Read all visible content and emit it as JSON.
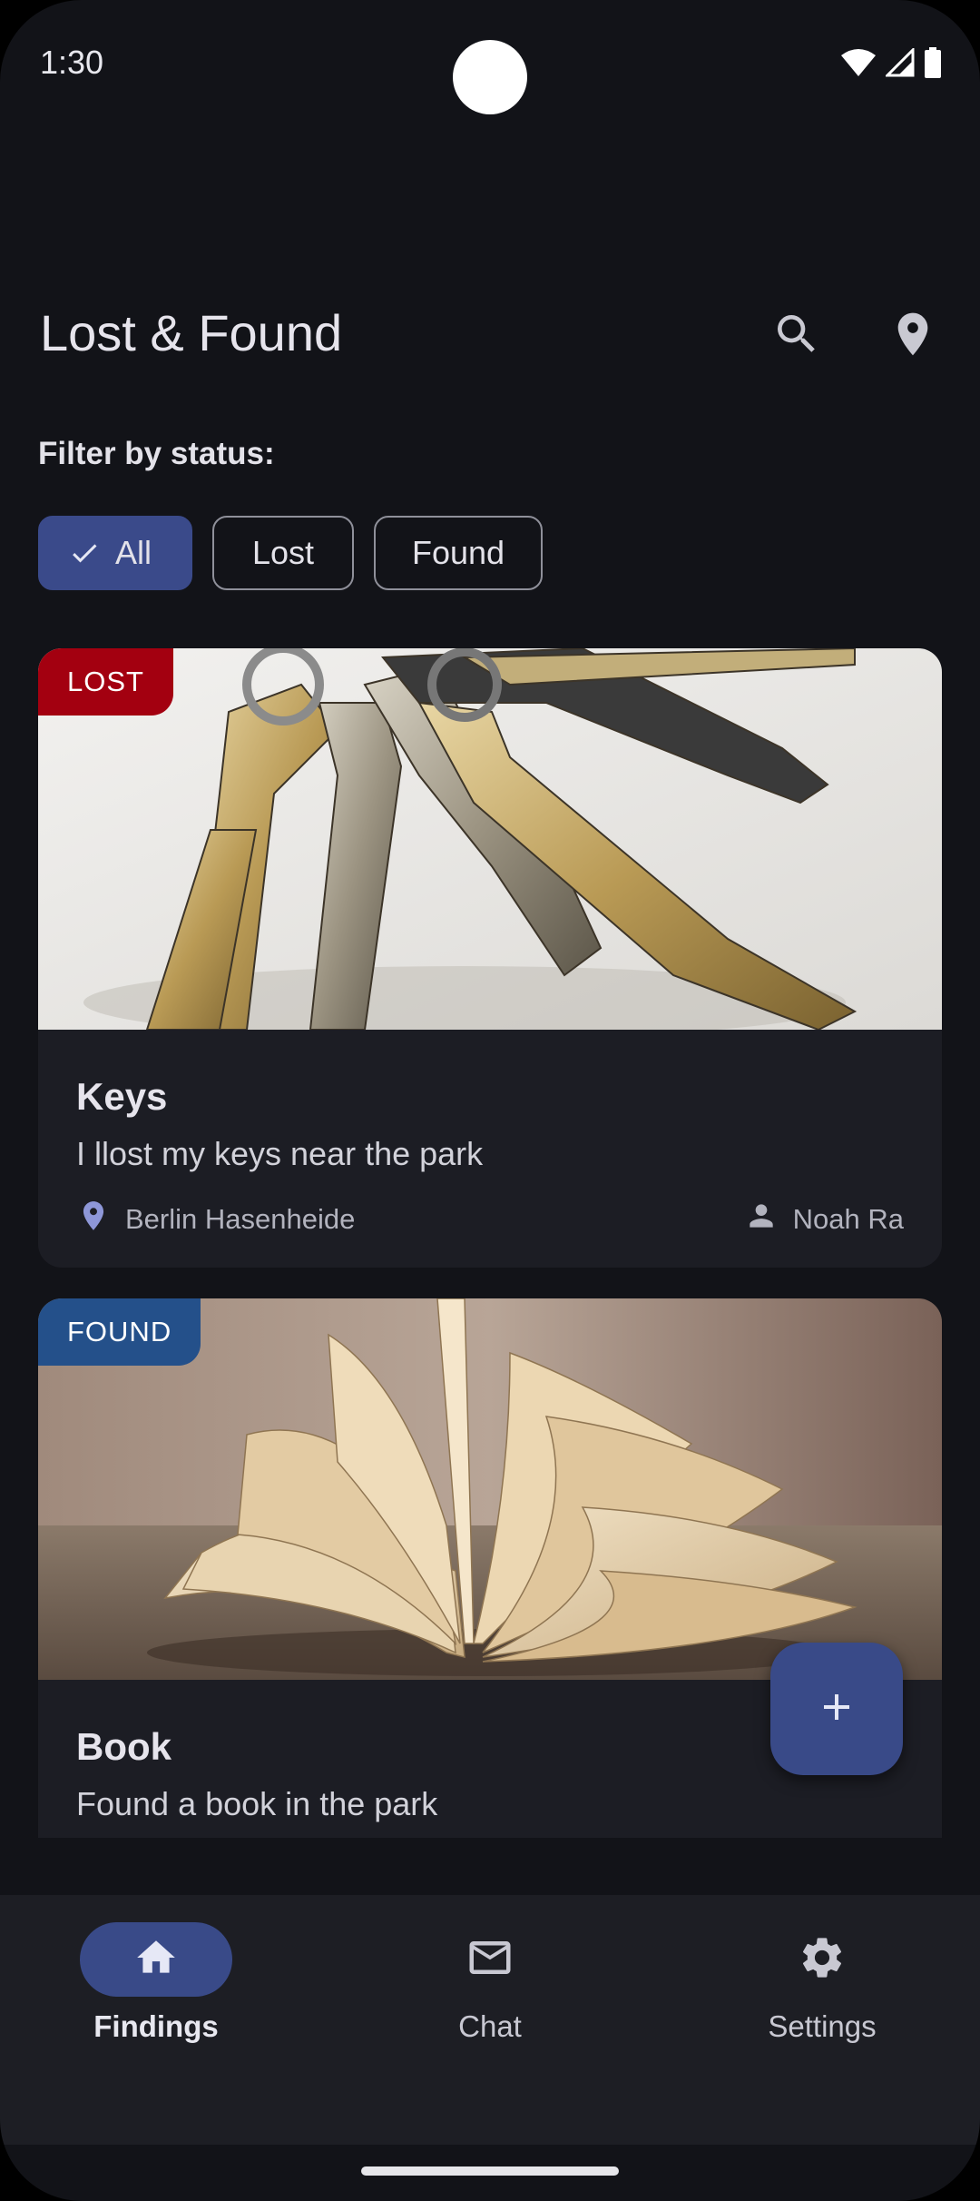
{
  "status_bar": {
    "time": "1:30"
  },
  "header": {
    "title": "Lost & Found",
    "search_icon": "search-icon",
    "location_icon": "location-pin-icon"
  },
  "filter": {
    "label": "Filter by status:",
    "chips": [
      {
        "label": "All",
        "selected": true
      },
      {
        "label": "Lost",
        "selected": false
      },
      {
        "label": "Found",
        "selected": false
      }
    ]
  },
  "items": [
    {
      "status": "LOST",
      "status_color": "#a30010",
      "title": "Keys",
      "description": "I llost my keys near the park",
      "location": "Berlin Hasenheide",
      "user": "Noah Ra"
    },
    {
      "status": "FOUND",
      "status_color": "#24508a",
      "title": "Book",
      "description": "Found a book in the park"
    }
  ],
  "fab": {
    "icon": "plus-icon"
  },
  "bottom_nav": {
    "items": [
      {
        "label": "Findings",
        "icon": "home-icon",
        "active": true
      },
      {
        "label": "Chat",
        "icon": "mail-icon",
        "active": false
      },
      {
        "label": "Settings",
        "icon": "gear-icon",
        "active": false
      }
    ]
  },
  "colors": {
    "background": "#121318",
    "accent": "#394a88",
    "card": "#1c1d24"
  }
}
